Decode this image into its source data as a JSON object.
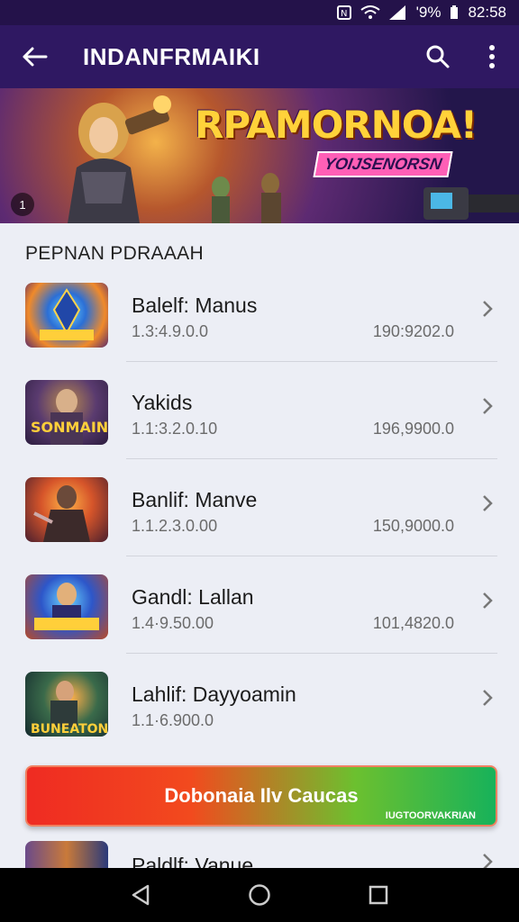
{
  "status_bar": {
    "battery": "'9%",
    "time": "82:58"
  },
  "toolbar": {
    "title": "INDANFRMAIKI"
  },
  "banner": {
    "headline": "RPAMORNOA!",
    "subhead": "YOIJSENORSN",
    "page_indicator": "1"
  },
  "section": {
    "title": "PEPNAN PDRAAAH"
  },
  "items": [
    {
      "name": "Balelf: Manus",
      "subtitle": "1.3:4.9.0.0",
      "value": "190:9202.0"
    },
    {
      "name": "Yakids",
      "subtitle": "1.1:3.2.0.10",
      "value": "196,9900.0"
    },
    {
      "name": "Banlif: Manve",
      "subtitle": "1.1.2.3.0.00",
      "value": "150,9000.0"
    },
    {
      "name": "Gandl: Lallan",
      "subtitle": "1.4·9.50.00",
      "value": "101,4820.0"
    },
    {
      "name": "Lahlif: Dayyoamin",
      "subtitle": "1.1·6.900.0",
      "value": ""
    }
  ],
  "thumb_texts": [
    "",
    "SONMAIN",
    "",
    "",
    "BUNEATON"
  ],
  "cta": {
    "label": "Dobonaia Ilv Caucas",
    "tag": "IUGTOORVAKRIAN"
  },
  "partial_item": {
    "name": "Paldlf: Vanue"
  },
  "colors": {
    "toolbar": "#2f1862",
    "status_bar": "#24124a",
    "cta_start": "#ef2b22",
    "cta_end": "#17b25a"
  }
}
